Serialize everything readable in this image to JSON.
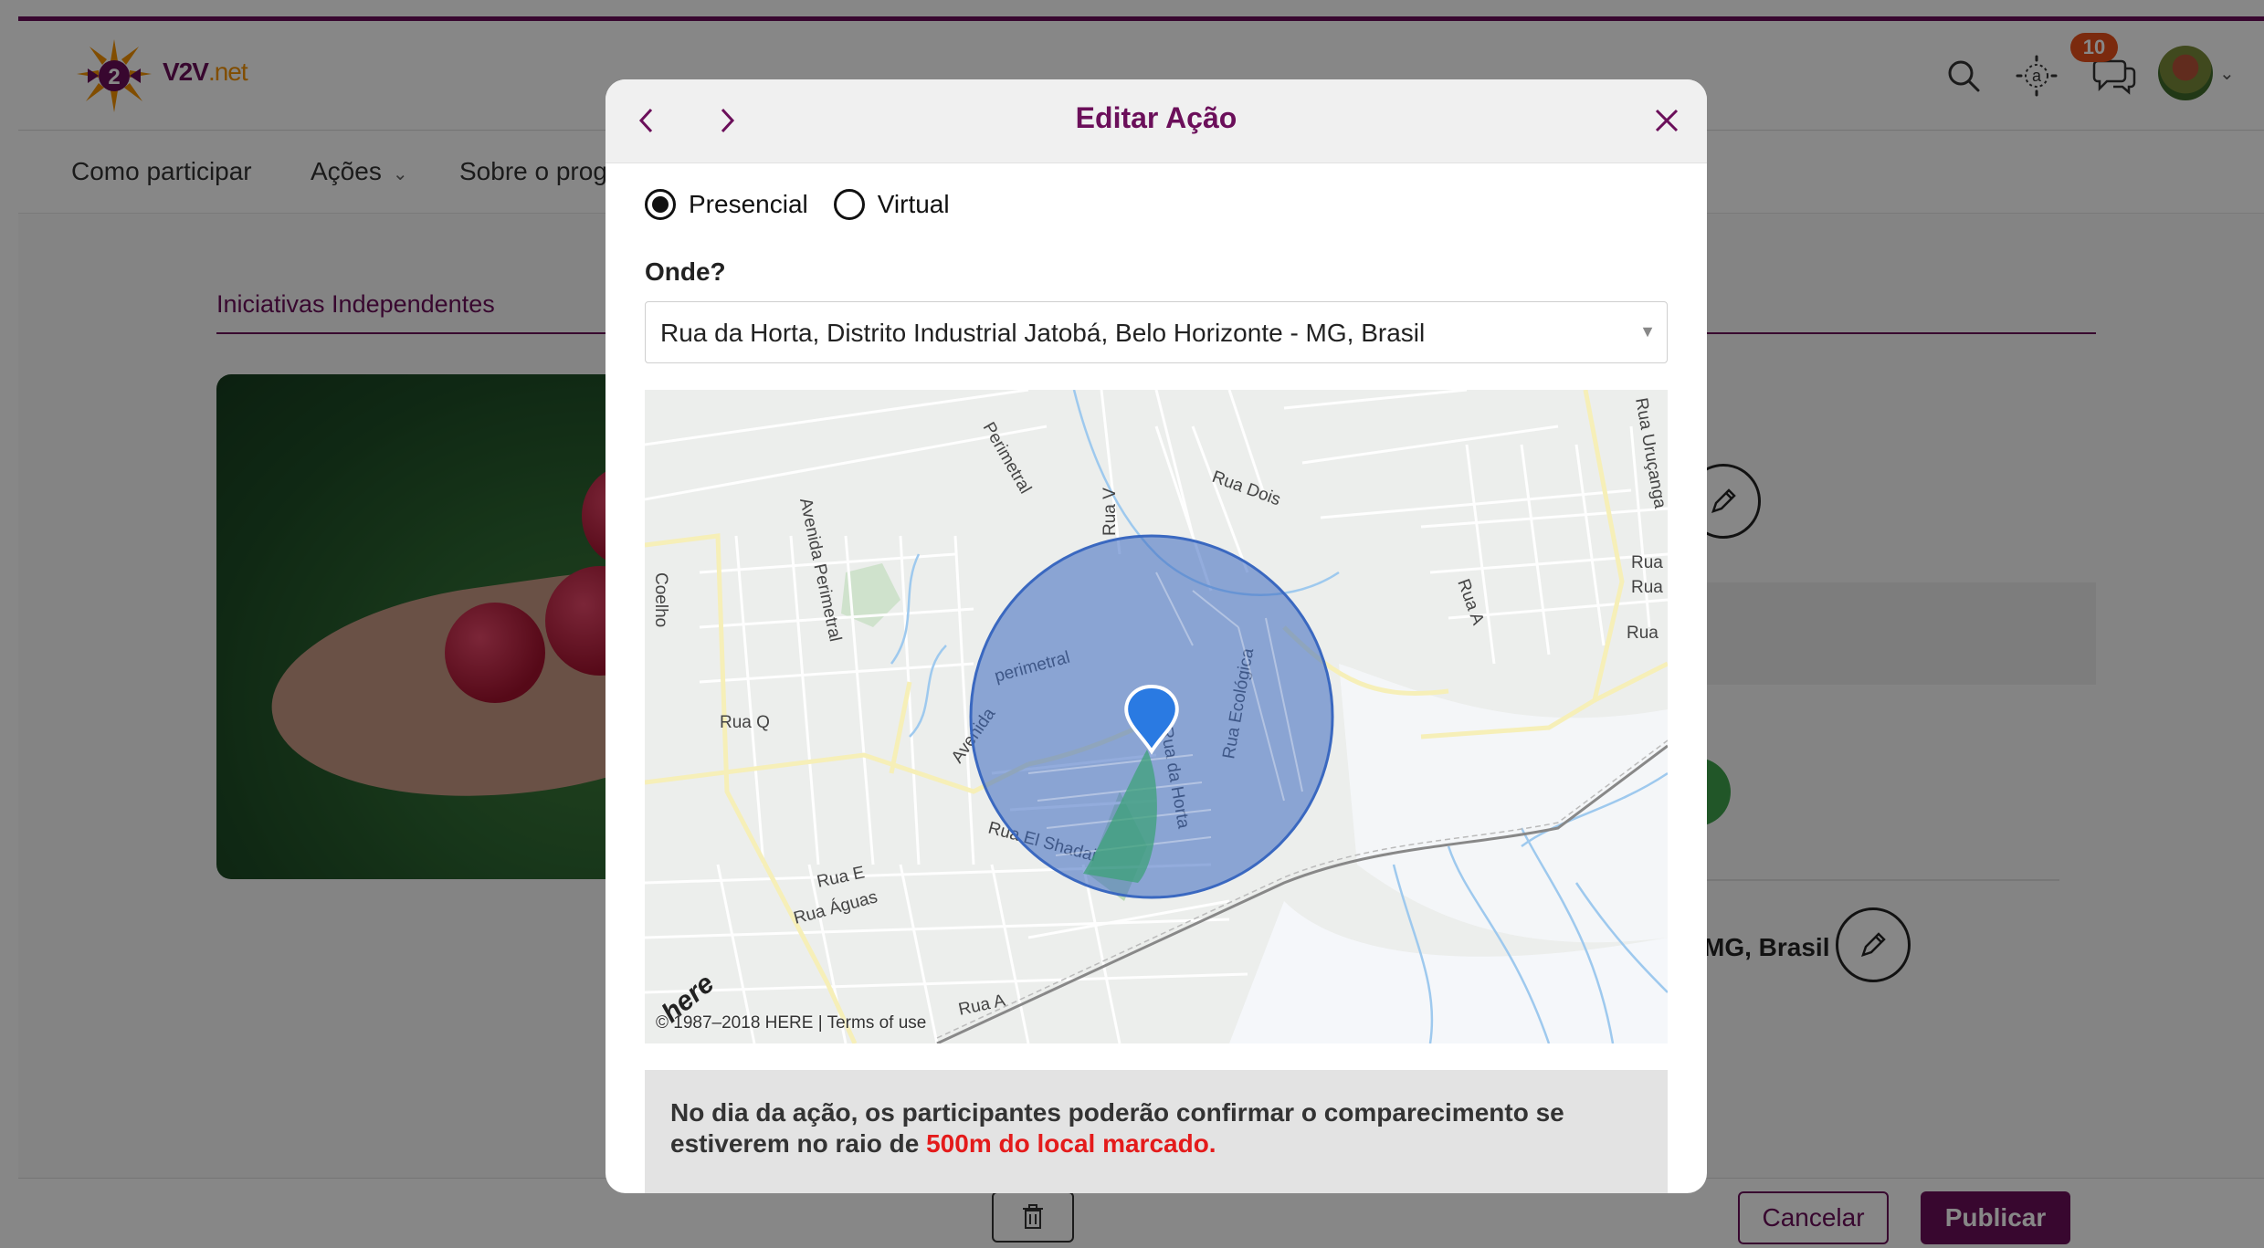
{
  "header": {
    "logo_text_main": "V2V",
    "logo_text_suffix": ".net",
    "notification_count": "10",
    "icons": [
      "search-icon",
      "accessibility-icon",
      "chat-icon",
      "avatar"
    ]
  },
  "nav": {
    "items": [
      {
        "label": "Como participar"
      },
      {
        "label": "Ações"
      },
      {
        "label": "Sobre o prog"
      }
    ]
  },
  "content": {
    "tab_label": "Iniciativas Independentes",
    "address_fragment": "MG, Brasil"
  },
  "footer": {
    "cancel_label": "Cancelar",
    "publish_label": "Publicar"
  },
  "modal": {
    "title": "Editar Ação",
    "mode_options": [
      {
        "label": "Presencial",
        "selected": true
      },
      {
        "label": "Virtual",
        "selected": false
      }
    ],
    "where_label": "Onde?",
    "location_value": "Rua da Horta, Distrito Industrial Jatobá, Belo Horizonte - MG, Brasil",
    "map": {
      "credit": "© 1987–2018 HERE | Terms of use",
      "logo": "here",
      "street_labels": [
        "Perimetral",
        "Rua V",
        "Rua Dois",
        "Rua Uruçanga",
        "Avenida Perimetral",
        "Coelho",
        "Rua A",
        "Rua Q",
        "perimetral",
        "Avenida",
        "Rua Ecológica",
        "Rua da Horta",
        "Rua El Shadai",
        "Rua E",
        "Rua Águas",
        "Rua A",
        "Rua",
        "Rua"
      ],
      "radius_color": "#4a78c8",
      "marker_color": "#2a7ae2"
    },
    "info_text_prefix": "No dia da ação, os participantes poderão confirmar o comparecimento se estiverem no raio de ",
    "info_text_highlight": "500m do local marcado."
  },
  "colors": {
    "brand": "#6b0f5a",
    "accent_orange": "#f39200",
    "badge": "#e8501c",
    "highlight_red": "#e41b1b"
  }
}
